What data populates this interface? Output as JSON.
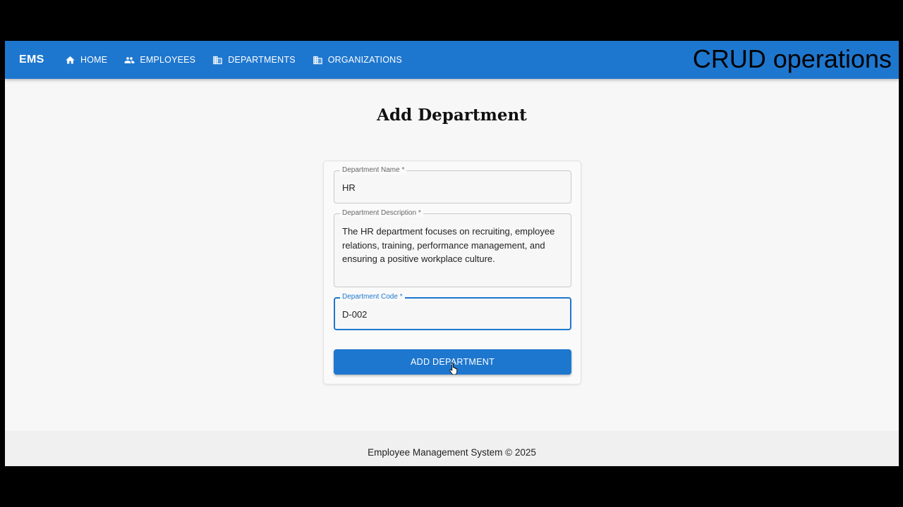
{
  "overlay": {
    "title": "CRUD operations"
  },
  "appbar": {
    "brand": "EMS",
    "nav": [
      {
        "label": "HOME",
        "icon": "home-icon"
      },
      {
        "label": "EMPLOYEES",
        "icon": "people-icon"
      },
      {
        "label": "DEPARTMENTS",
        "icon": "building-icon"
      },
      {
        "label": "ORGANIZATIONS",
        "icon": "building-icon"
      }
    ]
  },
  "page": {
    "title": "Add Department"
  },
  "form": {
    "name": {
      "label": "Department Name *",
      "value": "HR"
    },
    "description": {
      "label": "Department Description *",
      "value": "The HR department focuses on recruiting, employee relations, training, performance management, and ensuring a positive workplace culture."
    },
    "code": {
      "label": "Department Code *",
      "value": "D-002"
    },
    "submit_label": "ADD DEPARTMENT"
  },
  "footer": {
    "text": "Employee Management System © 2025"
  },
  "colors": {
    "primary": "#1e77cf",
    "background": "#f7f7f7"
  }
}
